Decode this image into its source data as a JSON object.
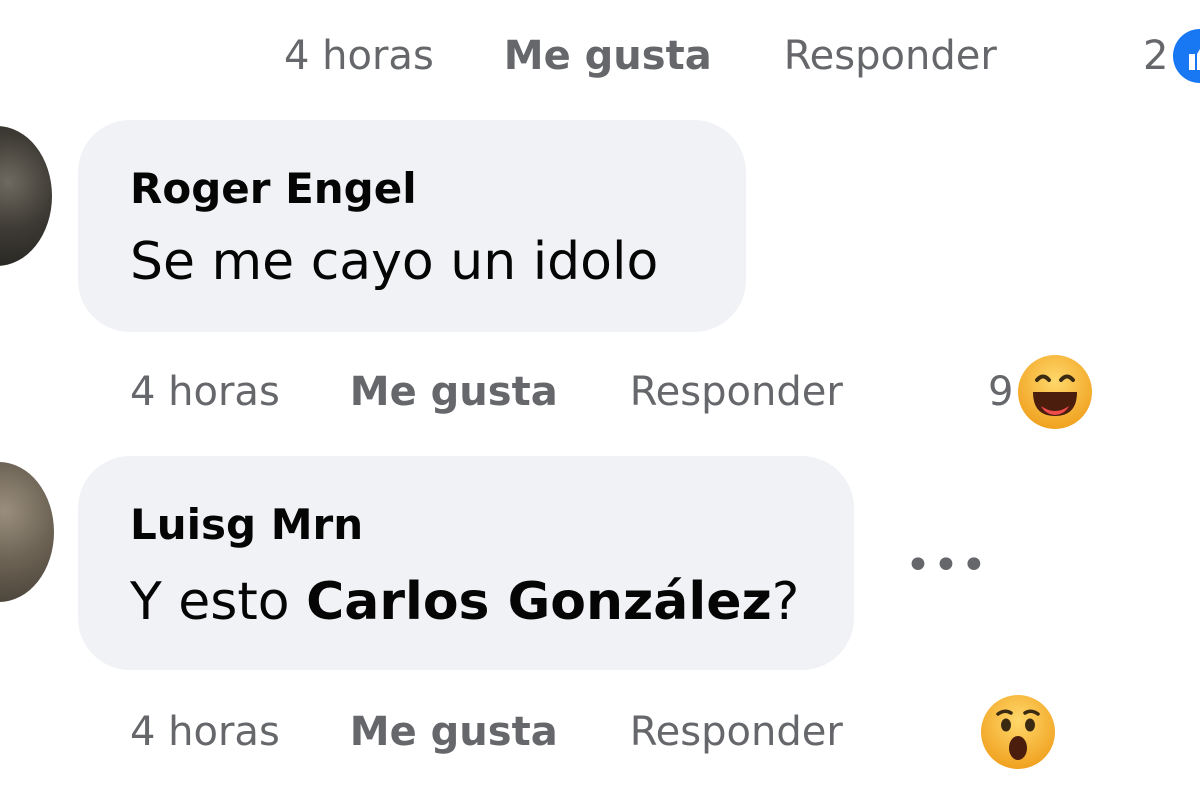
{
  "thread": {
    "top_row": {
      "time": "4 horas",
      "like": "Me gusta",
      "reply": "Responder",
      "reaction_count": "2",
      "reaction_icon": "like-icon"
    },
    "comments": [
      {
        "author": "Roger Engel",
        "text": "Se me cayo un idolo",
        "time": "4 horas",
        "like": "Me gusta",
        "reply": "Responder",
        "reaction_count": "9",
        "reaction_icon": "haha-icon"
      },
      {
        "author": "Luisg Mrn",
        "text_prefix": "Y esto ",
        "mention": "Carlos González",
        "text_suffix": "?",
        "time": "4 horas",
        "like": "Me gusta",
        "reply": "Responder",
        "reaction_icon": "wow-icon",
        "more_icon": "more-options-icon"
      }
    ]
  },
  "colors": {
    "bubble": "#f0f2f5",
    "secondary_text": "#65676b",
    "primary_text": "#050505",
    "like_blue": "#1877f2",
    "emoji_yellow": "#f7b125"
  }
}
